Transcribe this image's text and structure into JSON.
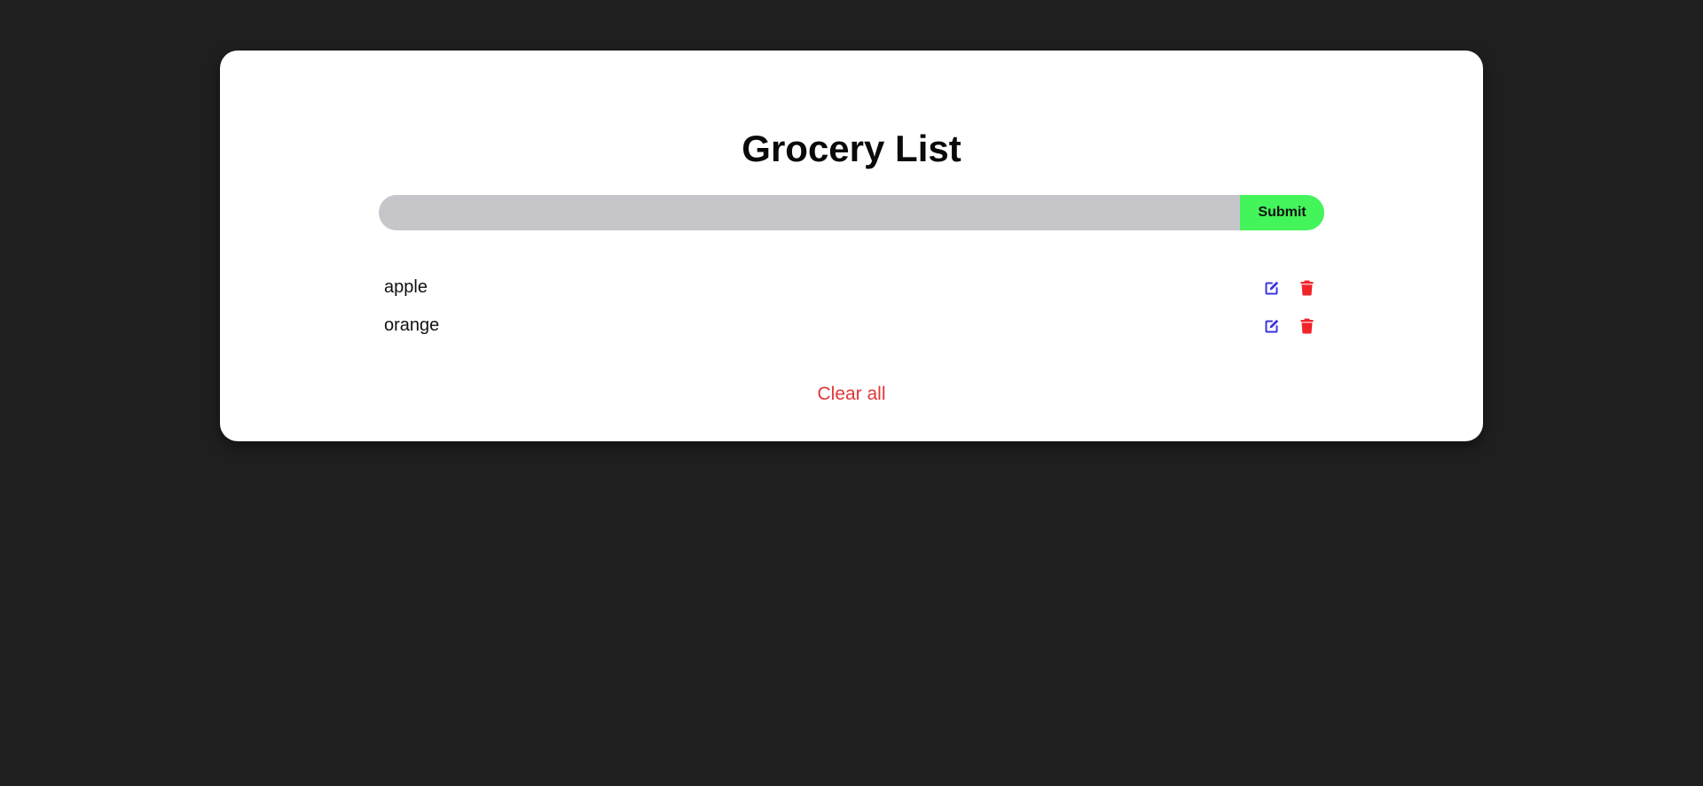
{
  "header": {
    "title": "Grocery List"
  },
  "form": {
    "input_value": "",
    "input_placeholder": "",
    "submit_label": "Submit"
  },
  "items": [
    {
      "name": "apple",
      "edit_icon": "edit-icon",
      "delete_icon": "trash-icon"
    },
    {
      "name": "orange",
      "edit_icon": "edit-icon",
      "delete_icon": "trash-icon"
    }
  ],
  "footer": {
    "clear_all_label": "Clear all"
  },
  "colors": {
    "background": "#1f1f1f",
    "card": "#ffffff",
    "input": "#c6c6ca",
    "submit": "#44f45b",
    "edit_icon": "#3a35e0",
    "delete_icon": "#f0252b",
    "clear_all": "#e0383a"
  }
}
